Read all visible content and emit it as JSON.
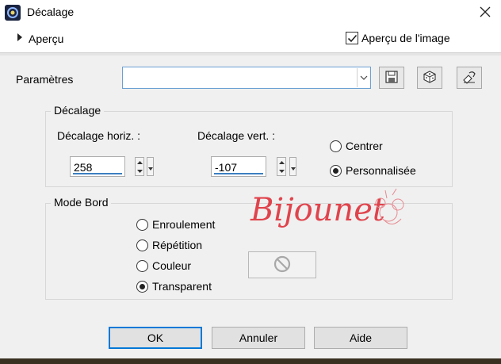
{
  "window": {
    "title": "Décalage",
    "icon": "app-icon",
    "close_icon": "close-icon"
  },
  "preview": {
    "toggle_label": "Aperçu",
    "image_preview_label": "Aperçu de l'image",
    "image_preview_checked": true
  },
  "params": {
    "label": "Paramètres",
    "preset_value": "",
    "save_icon": "save-icon",
    "random_icon": "dice-icon",
    "reset_icon": "reset-icon"
  },
  "offset_group": {
    "title": "Décalage",
    "horiz_label": "Décalage horiz. :",
    "horiz_value": "258",
    "vert_label": "Décalage vert. :",
    "vert_value": "-107",
    "options": [
      {
        "label": "Centrer",
        "checked": false
      },
      {
        "label": "Personnalisée",
        "checked": true
      }
    ]
  },
  "edge_group": {
    "title": "Mode Bord",
    "options": [
      {
        "label": "Enroulement",
        "checked": false
      },
      {
        "label": "Répétition",
        "checked": false
      },
      {
        "label": "Couleur",
        "checked": false
      },
      {
        "label": "Transparent",
        "checked": true
      }
    ],
    "color_swatch_icon": "no-color-icon"
  },
  "watermark_text": "Bijounet",
  "buttons": {
    "ok": "OK",
    "cancel": "Annuler",
    "help": "Aide"
  },
  "colors": {
    "accent": "#0078d7",
    "input_underline": "#3c7fc1",
    "watermark": "#e0434c"
  }
}
